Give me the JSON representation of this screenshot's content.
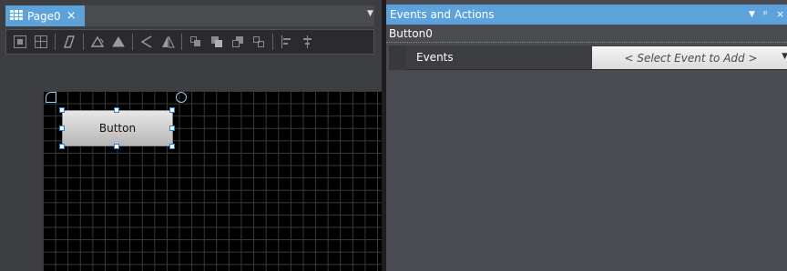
{
  "left_pane": {
    "tab": {
      "label": "Page0",
      "close_glyph": "×",
      "icon": "grid-page-icon"
    },
    "tabs_dropdown_glyph": "▼",
    "toolbar": {
      "icons": [
        "align-grid-icon",
        "align-grid-2-icon",
        "rotate-free-icon",
        "rotate-left-icon",
        "rotate-right-icon",
        "flip-horizontal-icon",
        "flip-vertical-icon",
        "bring-forward-icon",
        "bring-to-front-icon",
        "send-backward-icon",
        "send-to-back-icon",
        "align-left-icon",
        "align-center-icon"
      ]
    },
    "canvas": {
      "widget": {
        "label": "Button"
      }
    }
  },
  "right_pane": {
    "title": "Events and Actions",
    "controls": {
      "dropdown": "▼",
      "pin": "ᵖ",
      "close": "×"
    },
    "object_name": "Button0",
    "events_row": {
      "label": "Events",
      "select_placeholder": "< Select Event to Add >",
      "arrow_glyph": "▼"
    }
  }
}
